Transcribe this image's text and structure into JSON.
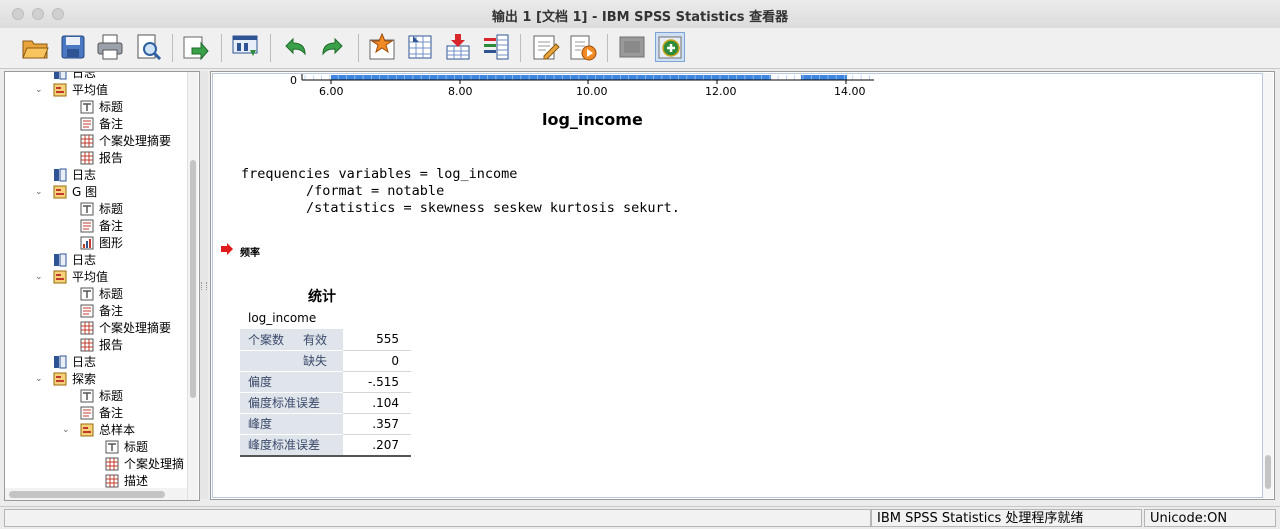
{
  "window": {
    "title": "输出 1 [文档 1] - IBM SPSS Statistics 查看器"
  },
  "toolbar": {
    "buttons": [
      {
        "name": "open-icon"
      },
      {
        "name": "save-icon"
      },
      {
        "name": "print-icon"
      },
      {
        "name": "print-preview-icon"
      },
      {
        "name": "export-icon"
      },
      {
        "name": "recall-dialog-icon"
      },
      {
        "name": "undo-icon"
      },
      {
        "name": "redo-icon"
      },
      {
        "name": "goto-case-icon"
      },
      {
        "name": "goto-variable-icon"
      },
      {
        "name": "insert-cases-icon"
      },
      {
        "name": "variables-icon"
      },
      {
        "name": "edit-icon"
      },
      {
        "name": "run-script-icon"
      },
      {
        "name": "hide-icon"
      },
      {
        "name": "show-icon"
      }
    ]
  },
  "outline": {
    "items": [
      {
        "label": "日志",
        "indent": 1,
        "icon": "log"
      },
      {
        "label": "平均值",
        "indent": 1,
        "icon": "proc",
        "expanded": true
      },
      {
        "label": "标题",
        "indent": 2,
        "icon": "title"
      },
      {
        "label": "备注",
        "indent": 2,
        "icon": "note"
      },
      {
        "label": "个案处理摘要",
        "indent": 2,
        "icon": "table"
      },
      {
        "label": "报告",
        "indent": 2,
        "icon": "table"
      },
      {
        "label": "日志",
        "indent": 1,
        "icon": "log"
      },
      {
        "label": "G 图",
        "indent": 1,
        "icon": "proc",
        "expanded": true
      },
      {
        "label": "标题",
        "indent": 2,
        "icon": "title"
      },
      {
        "label": "备注",
        "indent": 2,
        "icon": "note"
      },
      {
        "label": "图形",
        "indent": 2,
        "icon": "chart"
      },
      {
        "label": "日志",
        "indent": 1,
        "icon": "log"
      },
      {
        "label": "平均值",
        "indent": 1,
        "icon": "proc",
        "expanded": true
      },
      {
        "label": "标题",
        "indent": 2,
        "icon": "title"
      },
      {
        "label": "备注",
        "indent": 2,
        "icon": "note"
      },
      {
        "label": "个案处理摘要",
        "indent": 2,
        "icon": "table"
      },
      {
        "label": "报告",
        "indent": 2,
        "icon": "table"
      },
      {
        "label": "日志",
        "indent": 1,
        "icon": "log"
      },
      {
        "label": "探索",
        "indent": 1,
        "icon": "proc",
        "expanded": true
      },
      {
        "label": "标题",
        "indent": 2,
        "icon": "title"
      },
      {
        "label": "备注",
        "indent": 2,
        "icon": "note"
      },
      {
        "label": "总样本",
        "indent": 2,
        "icon": "proc",
        "expanded": true
      },
      {
        "label": "标题",
        "indent": 3,
        "icon": "title"
      },
      {
        "label": "个案处理摘",
        "indent": 3,
        "icon": "table"
      },
      {
        "label": "描述",
        "indent": 3,
        "icon": "table"
      }
    ]
  },
  "histogram": {
    "y_label": "0",
    "x_ticks": [
      "6.00",
      "8.00",
      "10.00",
      "12.00",
      "14.00"
    ],
    "x_title": "log_income"
  },
  "syntax": {
    "lines": [
      "frequencies variables = log_income",
      "        /format = notable",
      "        /statistics = skewness seskew kurtosis sekurt."
    ]
  },
  "section": {
    "title": "频率"
  },
  "stats_table": {
    "title": "统计",
    "variable": "log_income",
    "rows": [
      {
        "group": "个案数",
        "label": "有效",
        "value": "555"
      },
      {
        "group": "",
        "label": "缺失",
        "value": "0"
      },
      {
        "group": "偏度",
        "label": "",
        "value": "-.515"
      },
      {
        "group": "偏度标准误差",
        "label": "",
        "value": ".104"
      },
      {
        "group": "峰度",
        "label": "",
        "value": ".357"
      },
      {
        "group": "峰度标准误差",
        "label": "",
        "value": ".207"
      }
    ]
  },
  "status": {
    "processor": "IBM SPSS Statistics 处理程序就绪",
    "unicode": "Unicode:ON"
  }
}
